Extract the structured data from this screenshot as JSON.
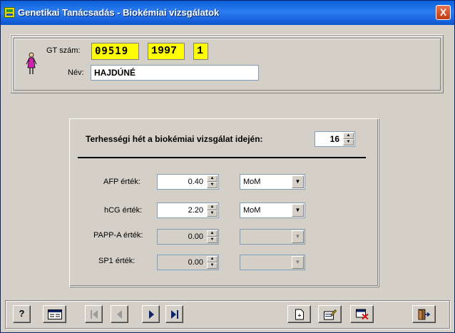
{
  "window": {
    "title": "Genetikai Tanácsadás - Biokémiai vizsgálatok",
    "close_label": "X"
  },
  "header": {
    "gt_label": "GT szám:",
    "gt_number_scrambled": "09519",
    "gt_year": "1997",
    "gt_seq": "1",
    "name_label": "Név:",
    "name_value": "HAJDÚNÉ"
  },
  "pregnancy": {
    "label": "Terhességi hét a biokémiai vizsgálat idején:",
    "week": "16"
  },
  "markers": [
    {
      "label": "AFP érték:",
      "value": "0.40",
      "unit": "MoM",
      "enabled": true
    },
    {
      "label": "hCG érték:",
      "value": "2.20",
      "unit": "MoM",
      "enabled": true
    },
    {
      "label": "PAPP-A érték:",
      "value": "0.00",
      "unit": "",
      "enabled": false
    },
    {
      "label": "SP1 érték:",
      "value": "0.00",
      "unit": "",
      "enabled": false
    }
  ],
  "toolbar": {
    "help_label": "?",
    "icons": [
      "help-icon",
      "records-icon",
      "first-record-icon",
      "previous-record-icon",
      "next-record-icon",
      "last-record-icon",
      "new-record-icon",
      "edit-record-icon",
      "delete-record-icon",
      "exit-icon"
    ]
  },
  "colors": {
    "title_bar": "#0a5fd8",
    "highlight_yellow": "#ffff00",
    "window_bg": "#d4d0c8",
    "delete_red": "#d01010"
  }
}
